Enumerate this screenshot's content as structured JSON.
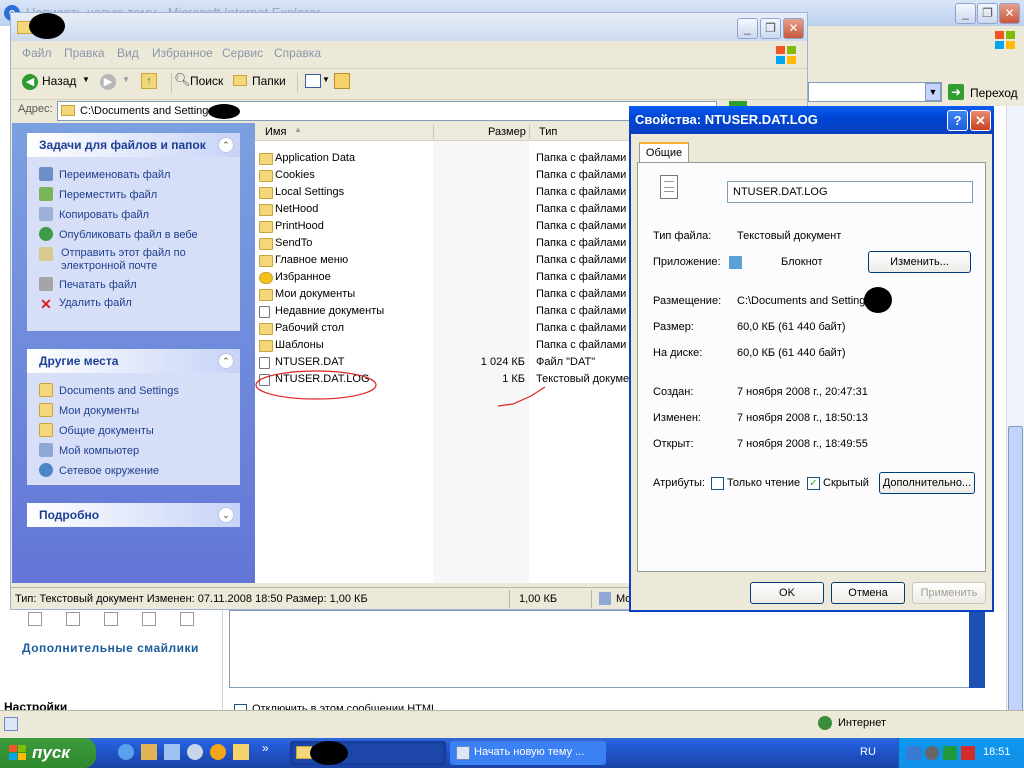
{
  "ie": {
    "title": "Написать новую тему - Microsoft Internet Explorer",
    "go_label": "Переход",
    "smileys_link": "Дополнительные смайлики",
    "settings_label": "Настройки",
    "html_option": "Отключить в этом сообщении HTML",
    "status_zone": "Интернет"
  },
  "explorer": {
    "menu": [
      "Файл",
      "Правка",
      "Вид",
      "Избранное",
      "Сервис",
      "Справка"
    ],
    "toolbar": {
      "back": "Назад",
      "search": "Поиск",
      "folders": "Папки"
    },
    "address_label": "Адрес:",
    "address_value": "C:\\Documents and Settings\\",
    "tasks_panel": {
      "title": "Задачи для файлов и папок",
      "items": [
        "Переименовать файл",
        "Переместить файл",
        "Копировать файл",
        "Опубликовать файл в вебе",
        "Отправить этот файл по электронной почте",
        "Печатать файл",
        "Удалить файл"
      ]
    },
    "places_panel": {
      "title": "Другие места",
      "items": [
        "Documents and Settings",
        "Мои документы",
        "Общие документы",
        "Мой компьютер",
        "Сетевое окружение"
      ]
    },
    "details_panel": {
      "title": "Подробно"
    },
    "columns": {
      "name": "Имя",
      "size": "Размер",
      "type": "Тип"
    },
    "files": [
      {
        "name": "Application Data",
        "size": "",
        "type": "Папка с файлами",
        "icon": "folder"
      },
      {
        "name": "Cookies",
        "size": "",
        "type": "Папка с файлами",
        "icon": "folder"
      },
      {
        "name": "Local Settings",
        "size": "",
        "type": "Папка с файлами",
        "icon": "folder"
      },
      {
        "name": "NetHood",
        "size": "",
        "type": "Папка с файлами",
        "icon": "folder"
      },
      {
        "name": "PrintHood",
        "size": "",
        "type": "Папка с файлами",
        "icon": "folder"
      },
      {
        "name": "SendTo",
        "size": "",
        "type": "Папка с файлами",
        "icon": "folder"
      },
      {
        "name": "Главное меню",
        "size": "",
        "type": "Папка с файлами",
        "icon": "folder"
      },
      {
        "name": "Избранное",
        "size": "",
        "type": "Папка с файлами",
        "icon": "star"
      },
      {
        "name": "Мои документы",
        "size": "",
        "type": "Папка с файлами",
        "icon": "folder"
      },
      {
        "name": "Недавние документы",
        "size": "",
        "type": "Папка с файлами",
        "icon": "doc-folder"
      },
      {
        "name": "Рабочий стол",
        "size": "",
        "type": "Папка с файлами",
        "icon": "folder"
      },
      {
        "name": "Шаблоны",
        "size": "",
        "type": "Папка с файлами",
        "icon": "folder"
      },
      {
        "name": "NTUSER.DAT",
        "size": "1 024 КБ",
        "type": "Файл \"DAT\"",
        "icon": "file"
      },
      {
        "name": "NTUSER.DAT.LOG",
        "size": "1 КБ",
        "type": "Текстовый докуме",
        "icon": "text-file"
      }
    ],
    "status": {
      "text": "Тип: Текстовый документ Изменен: 07.11.2008 18:50 Размер: 1,00 КБ",
      "size": "1,00 КБ",
      "zone": "Мо"
    }
  },
  "props": {
    "title": "Свойства: NTUSER.DAT.LOG",
    "tab": "Общие",
    "filename": "NTUSER.DAT.LOG",
    "type_label": "Тип файла:",
    "type_value": "Текстовый документ",
    "app_label": "Приложение:",
    "app_value": "Блокнот",
    "change_btn": "Изменить...",
    "location_label": "Размещение:",
    "location_value": "C:\\Documents and Setting",
    "size_label": "Размер:",
    "size_value": "60,0 КБ (61 440 байт)",
    "disk_label": "На диске:",
    "disk_value": "60,0 КБ (61 440 байт)",
    "created_label": "Создан:",
    "created_value": "7 ноября 2008 г., 20:47:31",
    "modified_label": "Изменен:",
    "modified_value": "7 ноября 2008 г., 18:50:13",
    "opened_label": "Открыт:",
    "opened_value": "7 ноября 2008 г., 18:49:55",
    "attrs_label": "Атрибуты:",
    "readonly_label": "Только чтение",
    "readonly": false,
    "hidden_label": "Скрытый",
    "hidden": true,
    "advanced_btn": "Дополнительно...",
    "ok": "OK",
    "cancel": "Отмена",
    "apply": "Применить"
  },
  "taskbar": {
    "start": "пуск",
    "task2": "Начать новую тему ...",
    "lang": "RU",
    "clock": "18:51"
  }
}
